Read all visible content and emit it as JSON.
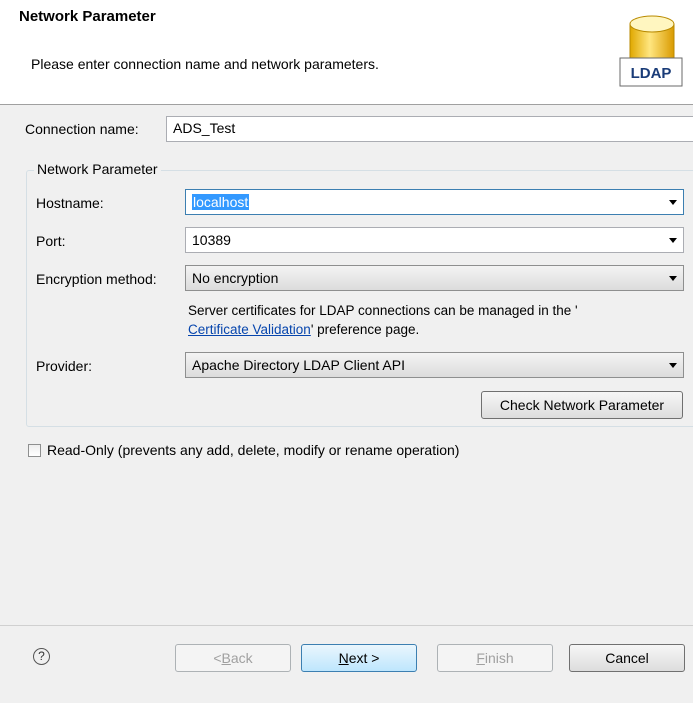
{
  "header": {
    "title": "Network Parameter",
    "subtitle": "Please enter connection name and network parameters.",
    "logo_text": "LDAP"
  },
  "connection": {
    "label": "Connection name:",
    "value": "ADS_Test"
  },
  "network_group": {
    "title": "Network Parameter",
    "hostname_label": "Hostname:",
    "hostname_value": "localhost",
    "port_label": "Port:",
    "port_value": "10389",
    "encryption_label": "Encryption method:",
    "encryption_value": "No encryption",
    "cert_info_line1": "Server certificates for LDAP connections can be managed in the '",
    "cert_link": "Certificate Validation",
    "cert_info_line2_suffix": "' preference page.",
    "provider_label": "Provider:",
    "provider_value": "Apache Directory LDAP Client API",
    "check_button": "Check Network Parameter"
  },
  "readonly_checkbox": {
    "label": "Read-Only (prevents any add, delete, modify or rename operation)",
    "checked": false
  },
  "footer": {
    "help_icon": "question-mark-icon",
    "back_prefix": "< ",
    "back_mnemonic": "B",
    "back_rest": "ack",
    "next_mnemonic": "N",
    "next_rest": "ext >",
    "finish_mnemonic": "F",
    "finish_rest": "inish",
    "cancel": "Cancel"
  },
  "colors": {
    "header_bg": "#ffffff",
    "dialog_bg": "#f0f0f0",
    "selection": "#3399ff",
    "link": "#0645ad",
    "logo_cylinder": "#f5c400"
  }
}
